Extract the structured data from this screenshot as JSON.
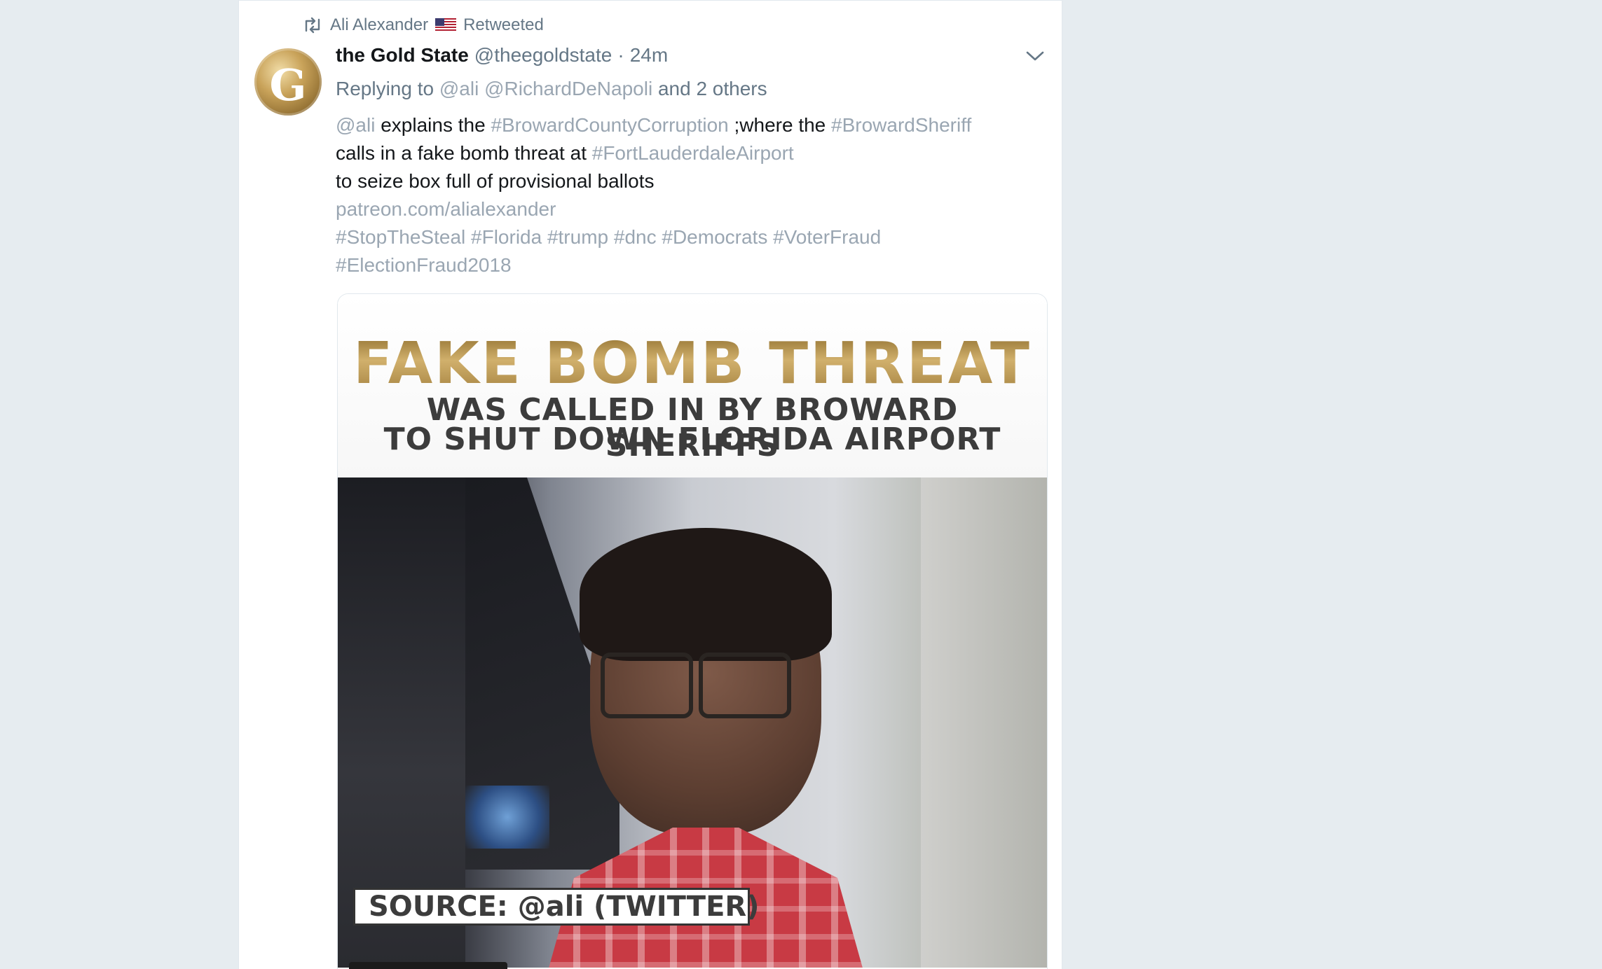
{
  "retweet": {
    "icon": "retweet-icon",
    "user": "Ali Alexander",
    "flag_icon": "us-flag-icon",
    "label": "Retweeted"
  },
  "tweet": {
    "display_name": "the Gold State",
    "handle": "@theegoldstate",
    "separator": "·",
    "time": "24m",
    "avatar_letter": "G",
    "replying_to_prefix": "Replying to",
    "replying_to_users": [
      "@ali",
      "@RichardDeNapoli"
    ],
    "replying_to_suffix": "and 2 others",
    "body": {
      "line1": {
        "mention": "@ali",
        "text1": " explains the ",
        "tag1": "#BrowardCountyCorruption",
        "text2": " ;where the ",
        "tag2": "#BrowardSheriff"
      },
      "line2": {
        "text": "calls in a fake bomb threat at ",
        "tag": "#FortLauderdaleAirport"
      },
      "line3": {
        "text": "to seize box full of provisional ballots"
      },
      "line4": {
        "link": "patreon.com/alialexander"
      },
      "line5": {
        "tags": "#StopTheSteal #Florida #trump #dnc #Democrats #VoterFraud"
      },
      "line6": {
        "tags": "#ElectionFraud2018"
      }
    }
  },
  "media": {
    "headline_1": "FAKE BOMB THREAT",
    "headline_2": "WAS CALLED IN BY BROWARD SHERIFFS",
    "headline_3": "TO SHUT DOWN FLORIDA AIRPORT",
    "source_label": "SOURCE: @ali (TWITTER)"
  },
  "colors": {
    "background": "#e6ecf0",
    "text_primary": "#14171a",
    "text_secondary": "#657786",
    "link_muted": "#9aa6b2",
    "gold": "#b39050"
  }
}
